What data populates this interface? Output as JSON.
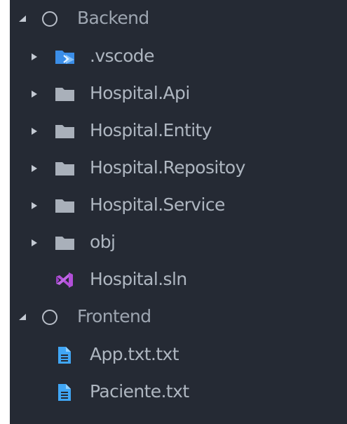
{
  "tree": {
    "backend": {
      "label": "Backend",
      "children": [
        {
          "label": ".vscode"
        },
        {
          "label": "Hospital.Api"
        },
        {
          "label": "Hospital.Entity"
        },
        {
          "label": "Hospital.Repositoy"
        },
        {
          "label": "Hospital.Service"
        },
        {
          "label": "obj"
        },
        {
          "label": "Hospital.sln"
        }
      ]
    },
    "frontend": {
      "label": "Frontend",
      "children": [
        {
          "label": "App.txt.txt"
        },
        {
          "label": "Paciente.txt"
        }
      ]
    }
  },
  "colors": {
    "panel_bg": "#252a34",
    "folder": "#a9b0ba",
    "vscode_folder": "#3b8ee8",
    "sln_icon": "#b24fd8",
    "file_icon": "#40a6f5"
  },
  "icons": {
    "root": "circle-outline-icon",
    "folder": "folder-icon",
    "vscode_folder": "vscode-folder-icon",
    "solution": "visual-studio-icon",
    "text_file": "document-icon",
    "collapsed": "triangle-right-icon",
    "expanded": "triangle-down-icon"
  }
}
